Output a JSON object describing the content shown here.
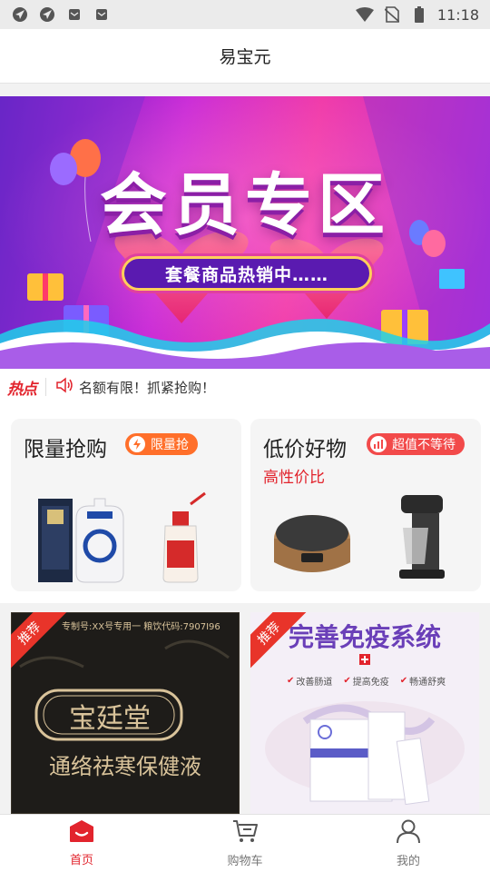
{
  "status_bar": {
    "time": "11:18",
    "left_icons": [
      "location-icon",
      "location-icon",
      "mail-icon",
      "mail-icon"
    ],
    "right_icons": [
      "wifi-icon",
      "no-sim-icon",
      "battery-icon"
    ]
  },
  "header": {
    "title": "易宝元"
  },
  "banner": {
    "title": "会员专区",
    "subtitle": "套餐商品热销中……",
    "colors": {
      "start": "#5b1fbf",
      "mid": "#c82bd8",
      "end": "#f03aa8"
    }
  },
  "notice": {
    "hot_label": "热点",
    "icon": "speaker-icon",
    "text": "名额有限！抓紧抢购！"
  },
  "promos": [
    {
      "title": "限量抢购",
      "badge": "限量抢",
      "badge_icon": "lightning-icon",
      "subtitle": "",
      "badge_color": "#ff6f2a"
    },
    {
      "title": "低价好物",
      "badge": "超值不等待",
      "badge_icon": "bar-chart-icon",
      "subtitle": "高性价比",
      "badge_color": "#f24a4a"
    }
  ],
  "recommend": [
    {
      "tag": "推荐",
      "image_text_top": "专制号:XX号专用一 粮饮代码:7907I96",
      "brand": "宝廷堂",
      "product": "通络祛寒保健液"
    },
    {
      "tag": "推荐",
      "headline": "完善免疫系统",
      "points": [
        "改善肠道",
        "提高免疫",
        "畅通舒爽"
      ]
    }
  ],
  "bottom_nav": [
    {
      "label": "首页",
      "icon": "home-icon",
      "active": true
    },
    {
      "label": "购物车",
      "icon": "cart-icon",
      "active": false
    },
    {
      "label": "我的",
      "icon": "user-icon",
      "active": false
    }
  ],
  "accent_color": "#e2242d"
}
